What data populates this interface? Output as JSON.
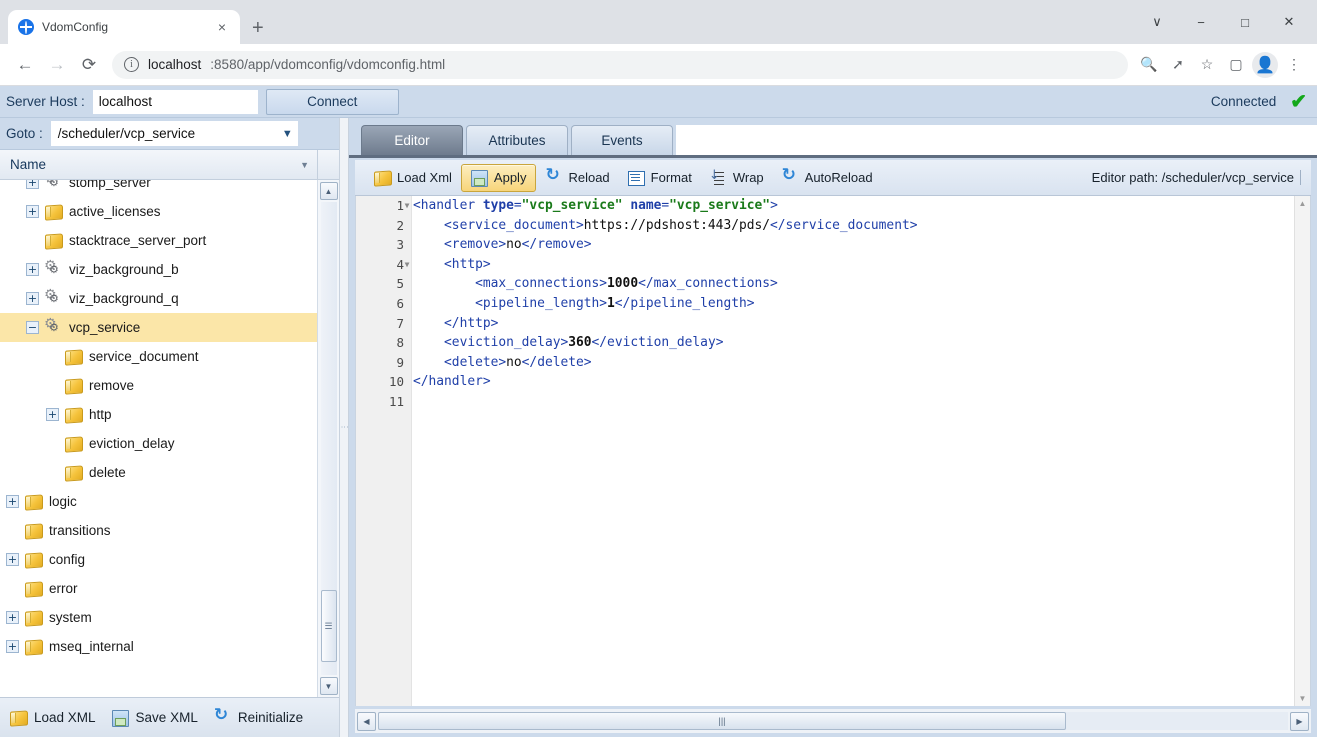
{
  "browser": {
    "tab_title": "VdomConfig",
    "tab_favicon": "globe-icon",
    "tab_close": "×",
    "new_tab": "+",
    "window_controls": [
      "∨",
      "−",
      "□",
      "✕"
    ],
    "nav": {
      "back": "←",
      "forward": "→",
      "reload": "⟳"
    },
    "url_info_icon": "ⓘ",
    "url_host": "localhost",
    "url_rest": ":8580/app/vdomconfig/vdomconfig.html",
    "omni_icons": [
      "zoom-icon",
      "share-icon",
      "bookmark-star-icon",
      "side-panel-icon",
      "profile-icon",
      "menu-kebab-icon"
    ]
  },
  "serverbar": {
    "label": "Server Host :",
    "host_value": "localhost",
    "host_placeholder": "localhost",
    "connect_label": "Connect",
    "status_text": "Connected",
    "status_icon": "check-icon",
    "status_color": "#13a81a"
  },
  "tree_panel": {
    "goto_label": "Goto :",
    "goto_value": "/scheduler/vcp_service",
    "column_header": "Name",
    "items": [
      {
        "label": "stomp_server",
        "indent": 1,
        "expander": "+",
        "icon": "gears"
      },
      {
        "label": "active_licenses",
        "indent": 1,
        "expander": "+",
        "icon": "folder"
      },
      {
        "label": "stacktrace_server_port",
        "indent": 1,
        "expander": "",
        "icon": "folder"
      },
      {
        "label": "viz_background_b",
        "indent": 1,
        "expander": "+",
        "icon": "gears"
      },
      {
        "label": "viz_background_q",
        "indent": 1,
        "expander": "+",
        "icon": "gears"
      },
      {
        "label": "vcp_service",
        "indent": 1,
        "expander": "−",
        "icon": "gears",
        "selected": true
      },
      {
        "label": "service_document",
        "indent": 2,
        "expander": "",
        "icon": "folder"
      },
      {
        "label": "remove",
        "indent": 2,
        "expander": "",
        "icon": "folder"
      },
      {
        "label": "http",
        "indent": 2,
        "expander": "+",
        "icon": "folder"
      },
      {
        "label": "eviction_delay",
        "indent": 2,
        "expander": "",
        "icon": "folder"
      },
      {
        "label": "delete",
        "indent": 2,
        "expander": "",
        "icon": "folder"
      },
      {
        "label": "logic",
        "indent": 0,
        "expander": "+",
        "icon": "folder"
      },
      {
        "label": "transitions",
        "indent": 0,
        "expander": "",
        "icon": "folder"
      },
      {
        "label": "config",
        "indent": 0,
        "expander": "+",
        "icon": "folder"
      },
      {
        "label": "error",
        "indent": 0,
        "expander": "",
        "icon": "folder"
      },
      {
        "label": "system",
        "indent": 0,
        "expander": "+",
        "icon": "folder"
      },
      {
        "label": "mseq_internal",
        "indent": 0,
        "expander": "+",
        "icon": "folder"
      }
    ],
    "footer": [
      {
        "label": "Load XML",
        "icon": "folder"
      },
      {
        "label": "Save XML",
        "icon": "floppy"
      },
      {
        "label": "Reinitialize",
        "icon": "refresh"
      }
    ],
    "selection_color": "#fbe6a8"
  },
  "editor": {
    "tabs": [
      {
        "label": "Editor",
        "active": true
      },
      {
        "label": "Attributes",
        "active": false
      },
      {
        "label": "Events",
        "active": false
      }
    ],
    "toolbar": [
      {
        "label": "Load Xml",
        "icon": "folder",
        "pressed": false
      },
      {
        "label": "Apply",
        "icon": "floppy",
        "pressed": true
      },
      {
        "label": "Reload",
        "icon": "refresh",
        "pressed": false
      },
      {
        "label": "Format",
        "icon": "format",
        "pressed": false
      },
      {
        "label": "Wrap",
        "icon": "wrap",
        "pressed": false
      },
      {
        "label": "AutoReload",
        "icon": "refresh",
        "pressed": false
      }
    ],
    "path_label": "Editor path: /scheduler/vcp_service",
    "line_numbers": [
      "1",
      "2",
      "3",
      "4",
      "5",
      "6",
      "7",
      "8",
      "9",
      "10",
      "11"
    ],
    "fold_lines": [
      1,
      4
    ],
    "code_lines": [
      {
        "n": 1,
        "indent": 0,
        "tokens": [
          {
            "t": "tag",
            "v": "<handler "
          },
          {
            "t": "attr",
            "v": "type"
          },
          {
            "t": "tag",
            "v": "="
          },
          {
            "t": "str",
            "v": "\"vcp_service\""
          },
          {
            "t": "tag",
            "v": " "
          },
          {
            "t": "attr",
            "v": "name"
          },
          {
            "t": "tag",
            "v": "="
          },
          {
            "t": "str",
            "v": "\"vcp_service\""
          },
          {
            "t": "tag",
            "v": ">"
          }
        ]
      },
      {
        "n": 2,
        "indent": 1,
        "tokens": [
          {
            "t": "tag",
            "v": "<service_document>"
          },
          {
            "t": "txt",
            "v": "https://pdshost:443/pds/"
          },
          {
            "t": "tag",
            "v": "</service_document>"
          }
        ]
      },
      {
        "n": 3,
        "indent": 1,
        "tokens": [
          {
            "t": "tag",
            "v": "<remove>"
          },
          {
            "t": "txt",
            "v": "no"
          },
          {
            "t": "tag",
            "v": "</remove>"
          }
        ]
      },
      {
        "n": 4,
        "indent": 1,
        "tokens": [
          {
            "t": "tag",
            "v": "<http>"
          }
        ]
      },
      {
        "n": 5,
        "indent": 2,
        "tokens": [
          {
            "t": "tag",
            "v": "<max_connections>"
          },
          {
            "t": "num",
            "v": "1000"
          },
          {
            "t": "tag",
            "v": "</max_connections>"
          }
        ]
      },
      {
        "n": 6,
        "indent": 2,
        "tokens": [
          {
            "t": "tag",
            "v": "<pipeline_length>"
          },
          {
            "t": "num",
            "v": "1"
          },
          {
            "t": "tag",
            "v": "</pipeline_length>"
          }
        ]
      },
      {
        "n": 7,
        "indent": 1,
        "tokens": [
          {
            "t": "tag",
            "v": "</http>"
          }
        ]
      },
      {
        "n": 8,
        "indent": 1,
        "tokens": [
          {
            "t": "tag",
            "v": "<eviction_delay>"
          },
          {
            "t": "num",
            "v": "360"
          },
          {
            "t": "tag",
            "v": "</eviction_delay>"
          }
        ]
      },
      {
        "n": 9,
        "indent": 1,
        "tokens": [
          {
            "t": "tag",
            "v": "<delete>"
          },
          {
            "t": "txt",
            "v": "no"
          },
          {
            "t": "tag",
            "v": "</delete>"
          }
        ]
      },
      {
        "n": 10,
        "indent": 0,
        "tokens": [
          {
            "t": "tag",
            "v": "</handler>"
          }
        ]
      },
      {
        "n": 11,
        "indent": 0,
        "tokens": []
      }
    ]
  }
}
